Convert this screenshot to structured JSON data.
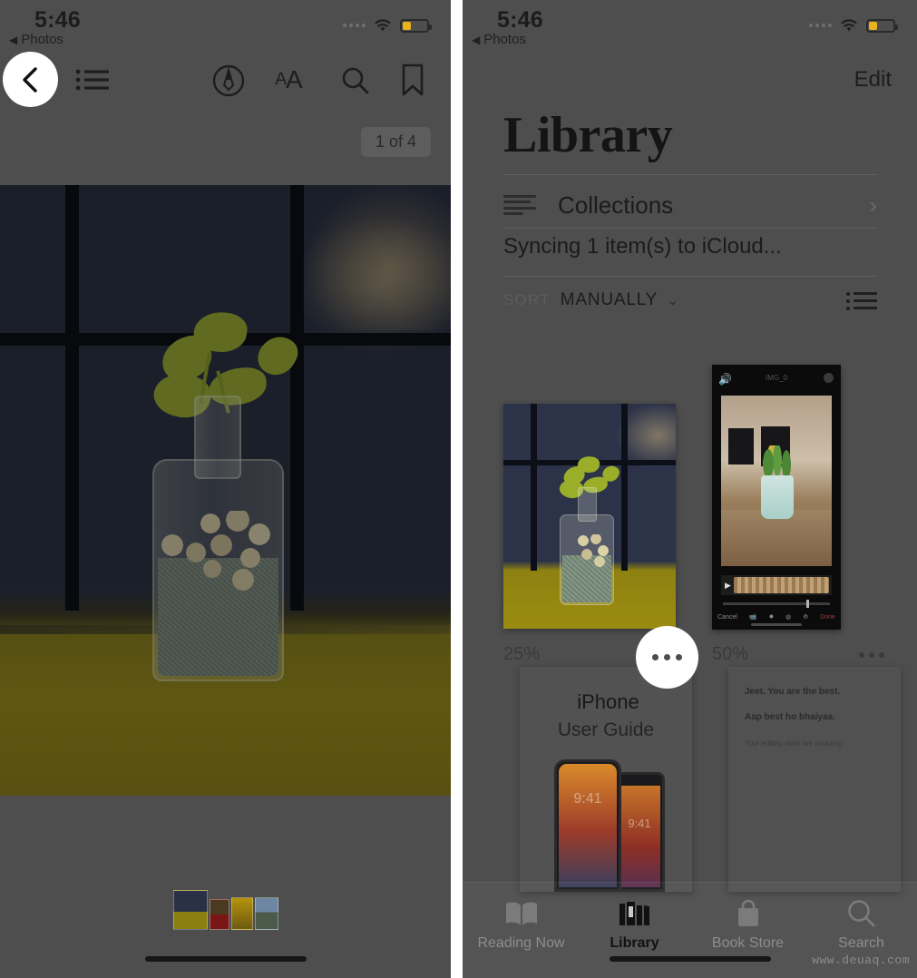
{
  "left_panel": {
    "status": {
      "time": "5:46",
      "back_label": "Photos",
      "back_triangle": "◀",
      "signal_icon": "cellular-dots-icon",
      "wifi_icon": "wifi-icon",
      "battery_icon": "battery-low-icon"
    },
    "toolbar": {
      "back_icon": "chevron-left-icon",
      "contents_icon": "table-of-contents-icon",
      "markup_icon": "markup-pen-icon",
      "text_size_label_small": "A",
      "text_size_label_large": "A",
      "search_icon": "search-icon",
      "bookmark_icon": "bookmark-icon"
    },
    "page_indicator": "1 of 4",
    "filmstrip_icon": "page-thumbnails-strip",
    "home_indicator": "home-bar"
  },
  "right_panel": {
    "status": {
      "time": "5:46",
      "back_label": "Photos",
      "back_triangle": "◀",
      "signal_icon": "cellular-dots-icon",
      "wifi_icon": "wifi-icon",
      "battery_icon": "battery-low-icon"
    },
    "edit_label": "Edit",
    "title": "Library",
    "collections": {
      "label": "Collections",
      "icon": "collections-lines-icon",
      "chevron": "›"
    },
    "sync_status": "Syncing 1 item(s) to iCloud...",
    "sort": {
      "label": "SORT",
      "value": "MANUALLY",
      "chevron": "⌄",
      "view_toggle_icon": "list-view-icon"
    },
    "books": [
      {
        "cover_type": "photo-plant-bottle",
        "progress": "25%",
        "more_icon": "ellipsis-icon"
      },
      {
        "cover_type": "screenshot-video-editor",
        "progress": "50%",
        "more_icon": "ellipsis-icon",
        "video_title": "IMG_0",
        "video_cancel": "Cancel",
        "video_done": "Done"
      },
      {
        "cover_type": "iphone-user-guide",
        "title_brand": "iPhone",
        "title_sub": "User Guide",
        "apple_logo": "",
        "phone_time_1": "9:41",
        "phone_time_2": "9:41"
      },
      {
        "cover_type": "text-document",
        "line_1": "Jeet. You are the best.",
        "line_2": "Aap best ho bhaiyaa.",
        "line_3": "Your editing skills are amazing."
      }
    ],
    "tabs": [
      {
        "label": "Reading Now",
        "icon": "open-book-icon",
        "active": false
      },
      {
        "label": "Library",
        "icon": "books-shelf-icon",
        "active": true
      },
      {
        "label": "Book Store",
        "icon": "shopping-bag-icon",
        "active": false
      },
      {
        "label": "Search",
        "icon": "search-icon",
        "active": false
      }
    ],
    "home_indicator": "home-bar"
  },
  "highlights": {
    "back_button_icon": "chevron-left-icon",
    "more_button_icon": "ellipsis-icon"
  },
  "watermark": "www.deuaq.com",
  "colors": {
    "dim_overlay": "#4e4e4e",
    "highlight_white": "#ffffff",
    "battery_yellow": "#e8b21a",
    "accent_yellow": "#f2e800"
  }
}
